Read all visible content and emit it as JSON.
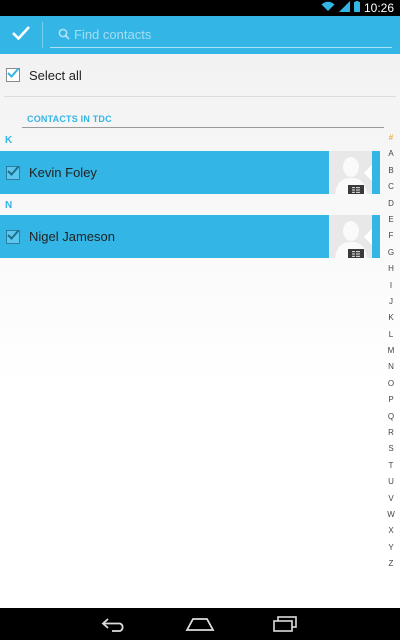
{
  "status_bar": {
    "time": "10:26"
  },
  "action_bar": {
    "search_placeholder": "Find contacts"
  },
  "select_all": {
    "label": "Select all"
  },
  "section": {
    "title": "CONTACTS IN TDC"
  },
  "groups": [
    {
      "letter": "K",
      "contact": {
        "name": "Kevin Foley",
        "checked": true
      }
    },
    {
      "letter": "N",
      "contact": {
        "name": "Nigel Jameson",
        "checked": true
      }
    }
  ],
  "alpha_index": [
    "#",
    "A",
    "B",
    "C",
    "D",
    "E",
    "F",
    "G",
    "H",
    "I",
    "J",
    "K",
    "L",
    "M",
    "N",
    "O",
    "P",
    "Q",
    "R",
    "S",
    "T",
    "U",
    "V",
    "W",
    "X",
    "Y",
    "Z"
  ],
  "colors": {
    "accent": "#33b5e5",
    "index_hash": "#e6a020"
  },
  "icons": {
    "done": "check-icon",
    "search": "search-icon",
    "wifi": "wifi-icon",
    "signal": "signal-icon",
    "battery": "battery-icon",
    "back": "back-icon",
    "home": "home-icon",
    "recents": "recents-icon",
    "avatar": "contact-avatar-icon"
  }
}
